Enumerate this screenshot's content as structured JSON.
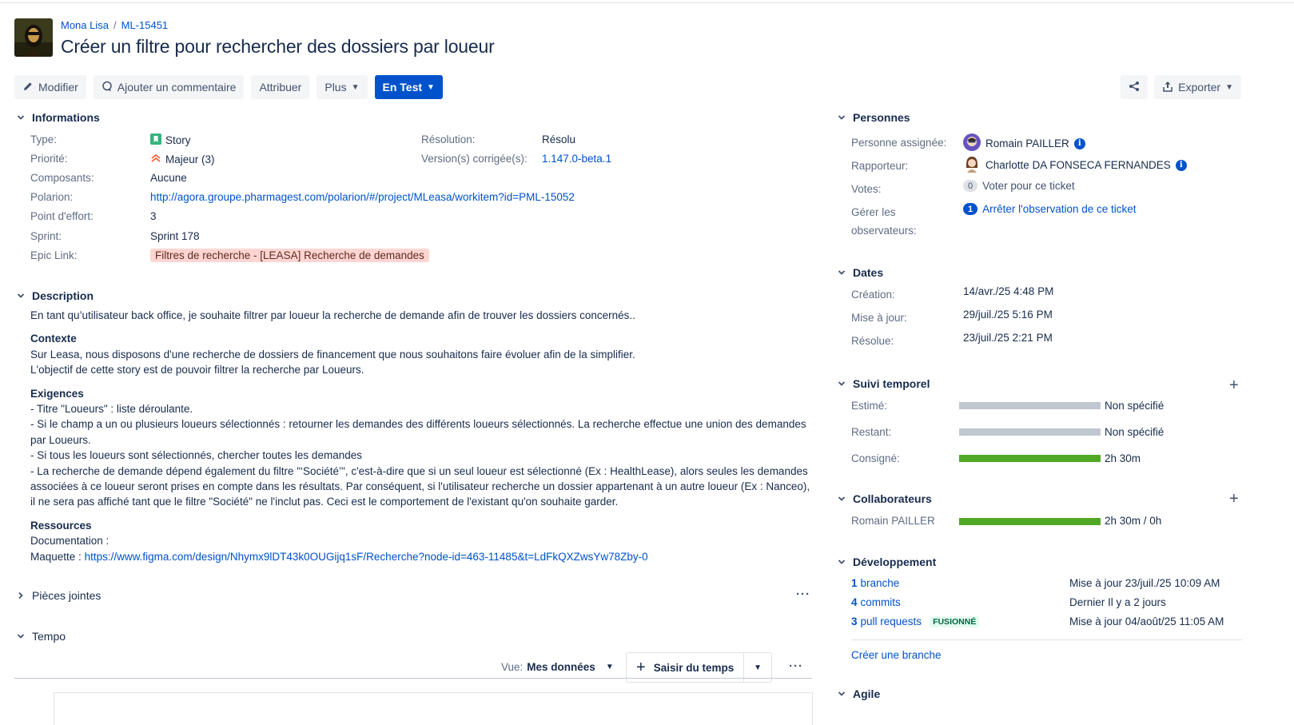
{
  "breadcrumb": {
    "project": "Mona Lisa",
    "issue_key": "ML-15451"
  },
  "title": "Créer un filtre pour rechercher des dossiers par loueur",
  "toolbar": {
    "edit": "Modifier",
    "comment": "Ajouter un commentaire",
    "assign": "Attribuer",
    "more": "Plus",
    "status": "En Test",
    "export": "Exporter"
  },
  "informations": {
    "heading": "Informations",
    "type_label": "Type:",
    "type": "Story",
    "priority_label": "Priorité:",
    "priority": "Majeur (3)",
    "components_label": "Composants:",
    "components": "Aucune",
    "polarion_label": "Polarion:",
    "polarion": "http://agora.groupe.pharmagest.com/polarion/#/project/MLeasa/workitem?id=PML-15052",
    "effort_label": "Point d'effort:",
    "effort": "3",
    "sprint_label": "Sprint:",
    "sprint": "Sprint 178",
    "epic_label": "Epic Link:",
    "epic": "Filtres de recherche - [LEASA] Recherche de demandes",
    "resolution_label": "Résolution:",
    "resolution": "Résolu",
    "fix_version_label": "Version(s) corrigée(s):",
    "fix_version": "1.147.0-beta.1"
  },
  "description": {
    "heading": "Description",
    "intro": "En tant qu’utilisateur back office, je souhaite filtrer par loueur la recherche de demande afin de trouver les dossiers concernés..",
    "context_heading": "Contexte",
    "context_1": "Sur Leasa, nous disposons d'une recherche de dossiers de financement que nous souhaitons faire évoluer afin de la simplifier.",
    "context_2": "L'objectif de cette story est de pouvoir filtrer la recherche par Loueurs.",
    "req_heading": "Exigences",
    "req_1": "- Titre \"Loueurs\" : liste déroulante.",
    "req_2": "- Si le champ a un ou plusieurs loueurs sélectionnés : retourner les demandes des différents loueurs sélectionnés. La recherche effectue une union des demandes par Loueurs.",
    "req_3": "- Si tous les loueurs sont sélectionnés, chercher toutes les demandes",
    "req_4": "- La recherche de demande dépend également du filtre \"‘Société’\", c'est-à-dire que si un seul loueur est sélectionné (Ex : HealthLease), alors seules les demandes associées à ce loueur seront prises en compte dans les résultats. Par conséquent, si l'utilisateur recherche un dossier appartenant à un autre loueur (Ex : Nanceo), il ne sera pas affiché tant que le filtre \"Société\" ne l'inclut pas. Ceci est le comportement de l'existant qu'on souhaite garder.",
    "res_heading": "Ressources",
    "res_doc": "Documentation :",
    "res_maquette_label": "Maquette :",
    "res_maquette_link": "https://www.figma.com/design/Nhymx9lDT43k0OUGijq1sF/Recherche?node-id=463-11485&t=LdFkQXZwsYw78Zby-0"
  },
  "attachments": {
    "heading": "Pièces jointes"
  },
  "tempo": {
    "heading": "Tempo",
    "view_label": "Vue:",
    "view_value": "Mes données",
    "log_time": "Saisir du temps"
  },
  "people": {
    "heading": "Personnes",
    "assignee_label": "Personne assignée:",
    "assignee": "Romain PAILLER",
    "reporter_label": "Rapporteur:",
    "reporter": "Charlotte DA FONSECA FERNANDES",
    "votes_label": "Votes:",
    "votes_count": "0",
    "vote_action": "Voter pour ce ticket",
    "watchers_label_1": "Gérer les",
    "watchers_label_2": "observateurs:",
    "watchers_count": "1",
    "watch_action": "Arrêter l'observation de ce ticket"
  },
  "dates": {
    "heading": "Dates",
    "created_label": "Création:",
    "created": "14/avr./25 4:48 PM",
    "updated_label": "Mise à jour:",
    "updated": "29/juil./25 5:16 PM",
    "resolved_label": "Résolue:",
    "resolved": "23/juil./25 2:21 PM"
  },
  "time_tracking": {
    "heading": "Suivi temporel",
    "estimated_label": "Estimé:",
    "estimated": "Non spécifié",
    "remaining_label": "Restant:",
    "remaining": "Non spécifié",
    "logged_label": "Consigné:",
    "logged": "2h 30m",
    "logged_fraction": 1.0
  },
  "collaborators": {
    "heading": "Collaborateurs",
    "name": "Romain PAILLER",
    "value": "2h 30m / 0h",
    "fraction": 1.0
  },
  "development": {
    "heading": "Développement",
    "branch_count": "1",
    "branch_label": "branche",
    "branch_info": "Mise à jour 23/juil./25 10:09 AM",
    "commit_count": "4",
    "commit_label": "commits",
    "commit_info": "Dernier Il y a 2 jours",
    "pr_count": "3",
    "pr_label": "pull requests",
    "pr_badge": "FUSIONNÉ",
    "pr_info": "Mise à jour 04/août/25 11:05 AM",
    "create_branch": "Créer une branche"
  },
  "agile": {
    "heading": "Agile"
  },
  "colors": {
    "primary": "#0052cc",
    "logged_bar": "#51a825",
    "empty_bar": "#c1c7d0",
    "epic_bg": "#ffd5d2"
  }
}
